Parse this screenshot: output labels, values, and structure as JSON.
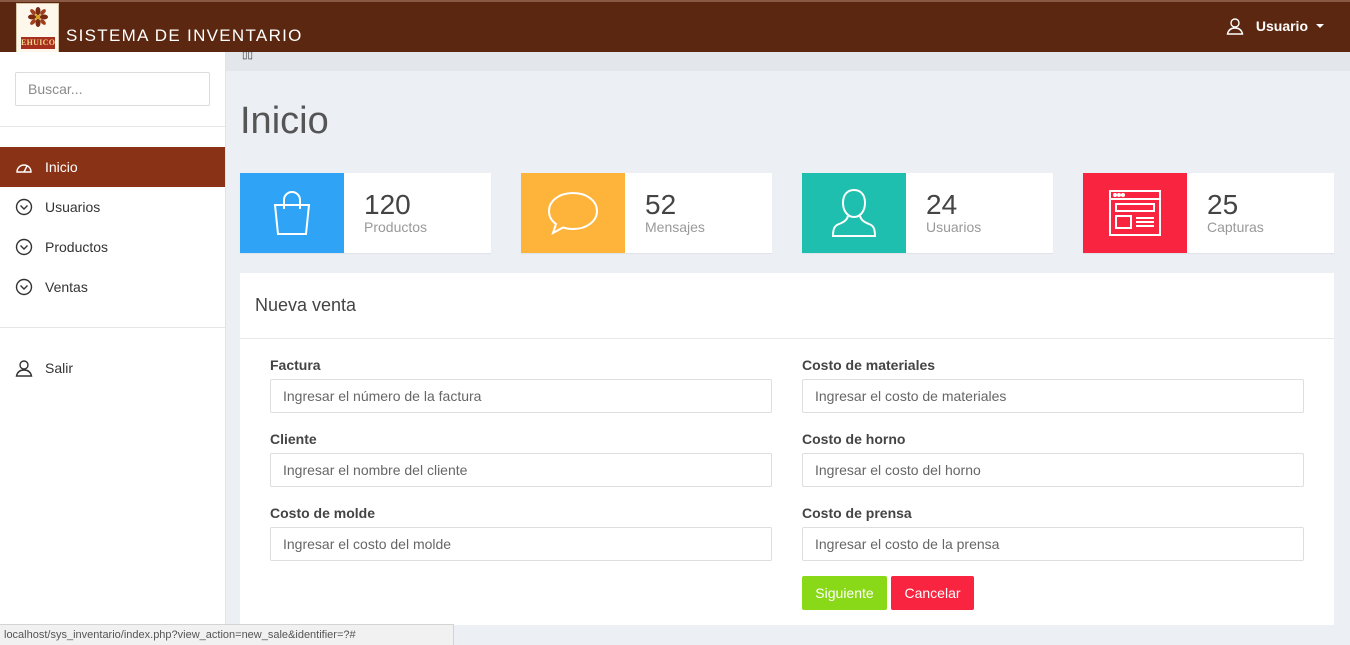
{
  "header": {
    "logo_text": "EHUICO",
    "brand": "SISTEMA DE INVENTARIO",
    "user_label": "Usuario",
    "bg_color": "#5b2710"
  },
  "sidebar": {
    "search_placeholder": "Buscar...",
    "items": [
      {
        "label": "Inicio",
        "icon": "dashboard-icon",
        "active": true
      },
      {
        "label": "Usuarios",
        "icon": "chevron-circle-icon",
        "active": false
      },
      {
        "label": "Productos",
        "icon": "chevron-circle-icon",
        "active": false
      },
      {
        "label": "Ventas",
        "icon": "chevron-circle-icon",
        "active": false
      }
    ],
    "logout_label": "Salir",
    "active_color": "#8a3215"
  },
  "breadcrumb": {
    "icon": "home-icon",
    "glyph": "▯▯"
  },
  "page": {
    "title": "Inicio"
  },
  "stats": [
    {
      "value": "120",
      "label": "Productos",
      "color": "#2fa4f7",
      "icon": "shopping-bag-icon"
    },
    {
      "value": "52",
      "label": "Mensajes",
      "color": "#feb43a",
      "icon": "speech-bubble-icon"
    },
    {
      "value": "24",
      "label": "Usuarios",
      "color": "#1ebfae",
      "icon": "user-icon"
    },
    {
      "value": "25",
      "label": "Capturas",
      "color": "#f9243f",
      "icon": "browser-window-icon"
    }
  ],
  "form": {
    "title": "Nueva venta",
    "fields": [
      {
        "label": "Factura",
        "placeholder": "Ingresar el número de la factura"
      },
      {
        "label": "Costo de materiales",
        "placeholder": "Ingresar el costo de materiales"
      },
      {
        "label": "Cliente",
        "placeholder": "Ingresar el nombre del cliente"
      },
      {
        "label": "Costo de horno",
        "placeholder": "Ingresar el costo del horno"
      },
      {
        "label": "Costo de molde",
        "placeholder": "Ingresar el costo del molde"
      },
      {
        "label": "Costo de prensa",
        "placeholder": "Ingresar el costo de la prensa"
      }
    ],
    "submit_label": "Siguiente",
    "submit_color": "#8ad919",
    "cancel_label": "Cancelar",
    "cancel_color": "#f9243f"
  },
  "statusbar": {
    "url": "localhost/sys_inventario/index.php?view_action=new_sale&identifier=?#"
  }
}
